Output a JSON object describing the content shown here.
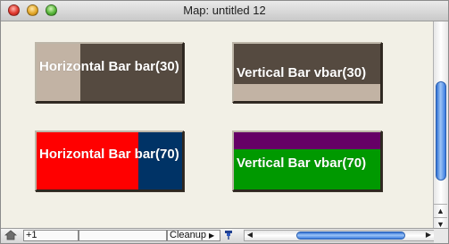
{
  "window": {
    "title": "Map: untitled 12"
  },
  "widgets": [
    {
      "kind": "horizontal",
      "label": "Horizontal Bar bar(30)",
      "percent": 30,
      "fill_color": "#c2b3a4",
      "bg_color": "#554a40"
    },
    {
      "kind": "vertical",
      "label": "Vertical Bar vbar(30)",
      "percent": 30,
      "fill_color": "#c2b3a4",
      "bg_color": "#554a40"
    },
    {
      "kind": "horizontal",
      "label": "Horizontal Bar bar(70)",
      "percent": 70,
      "fill_color": "#ff0000",
      "bg_color": "#003366"
    },
    {
      "kind": "vertical",
      "label": "Vertical Bar vbar(70)",
      "percent": 70,
      "fill_color": "#009900",
      "bg_color": "#660066"
    }
  ],
  "bottombar": {
    "zoom_value": "+1",
    "cleanup_label": "Cleanup",
    "cleanup_arrow": "▶"
  },
  "icons": {
    "home": "home-icon",
    "pin": "pin-icon",
    "left_arrow": "◀",
    "right_arrow": "▶",
    "up_arrow": "▲",
    "down_arrow": "▼"
  }
}
